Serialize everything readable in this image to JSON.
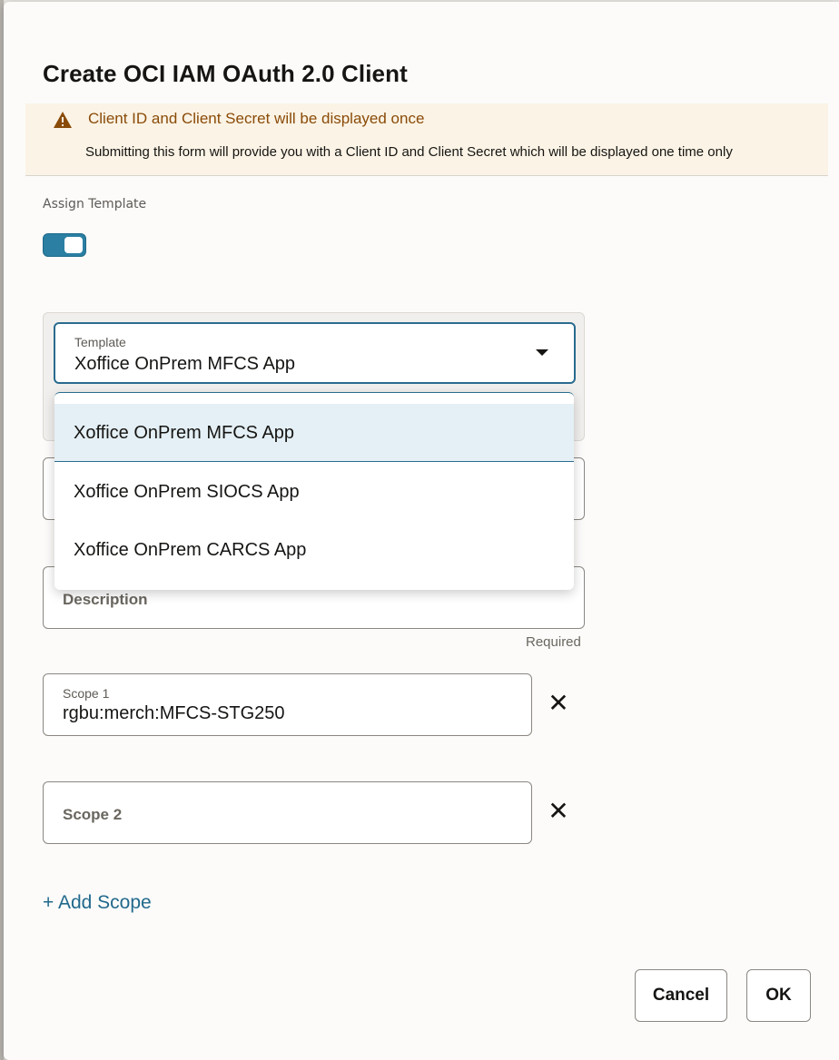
{
  "dialog": {
    "title": "Create OCI IAM OAuth 2.0 Client"
  },
  "banner": {
    "icon": "warning-icon",
    "title": "Client ID and Client Secret will be displayed once",
    "text": "Submitting this form will provide you with a Client ID and Client Secret which will be displayed one time only",
    "accent_color": "#8a4b08",
    "background": "#fbf3e5"
  },
  "assign_template": {
    "label": "Assign Template",
    "enabled": true,
    "toggle_color": "#2a7fa3"
  },
  "template_field": {
    "label": "Template",
    "value": "Xoffice OnPrem MFCS App",
    "options": [
      "Xoffice OnPrem MFCS App",
      "Xoffice OnPrem SIOCS App",
      "Xoffice OnPrem CARCS App"
    ],
    "selected_index": 0
  },
  "description_field": {
    "placeholder": "Description",
    "helper": "Required"
  },
  "scopes": [
    {
      "label": "Scope 1",
      "value": "rgbu:merch:MFCS-STG250"
    },
    {
      "placeholder": "Scope 2"
    }
  ],
  "remove_icon": "close-icon",
  "add_scope_label": "+ Add Scope",
  "link_color": "#22698c",
  "buttons": {
    "cancel": "Cancel",
    "ok": "OK"
  }
}
